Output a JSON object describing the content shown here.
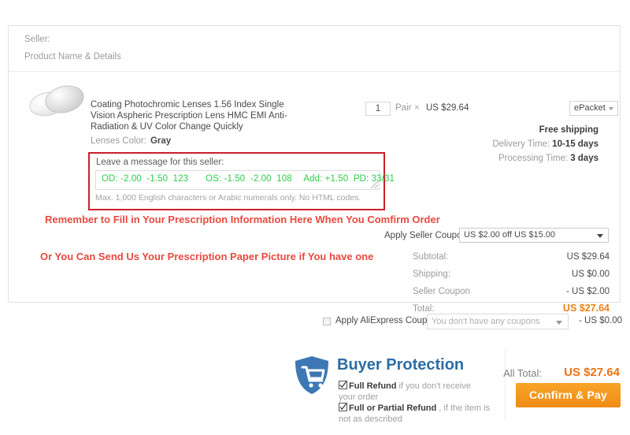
{
  "card": {
    "seller_label": "Seller:",
    "product_header": "Product Name & Details"
  },
  "product": {
    "title": "Coating Photochromic Lenses 1.56 Index Single Vision Aspheric Prescription Lens HMC EMI Anti-Radiation & UV Color Change Quickly",
    "color_label": "Lenses Color:",
    "color_value": "Gray",
    "quantity": "1",
    "unit": "Pair",
    "times": "×",
    "unit_price": "US $29.64",
    "thumbnail_icon": "eyeglass-lenses-icon"
  },
  "message": {
    "label": "Leave a message for this seller:",
    "value": "OD: -2.00  -1.50  123        OS: -1.50  -2.00  108     Add: +1.50  PD: 33/31",
    "prescription": {
      "od_label": "OD:",
      "od_sphere": "-2.00",
      "od_cylinder": "-1.50",
      "od_axis": "123",
      "os_label": "OS:",
      "os_sphere": "-1.50",
      "os_cylinder": "-2.00",
      "os_axis": "108",
      "add_label": "Add:",
      "add_value": "+1.50",
      "pd_label": "PD:",
      "pd_value": "33/31"
    },
    "hint": "Max. 1,000 English characters or Arabic numerals only. No HTML codes.",
    "text_color": "#2ecc4a",
    "box_color": "#cc1f2b"
  },
  "annotations": {
    "note_1": "Remember to Fill in Your Prescription Information Here When You Comfirm Order",
    "note_2": "Or You Can Send Us Your Prescription Paper Picture if You have one",
    "color": "#e8493f"
  },
  "shipping": {
    "method": "ePacket",
    "free_shipping": "Free shipping",
    "delivery_label": "Delivery Time:",
    "delivery_value": "10-15 days",
    "processing_label": "Processing Time:",
    "processing_value": "3 days"
  },
  "seller_coupon": {
    "label": "Apply Seller Coupon:",
    "selected": "US $2.00 off US $15.00"
  },
  "totals": [
    {
      "label": "Subtotal:",
      "value": "US $29.64"
    },
    {
      "label": "Shipping:",
      "value": "US $0.00"
    },
    {
      "label": "Seller Coupon",
      "value": "- US $2.00"
    },
    {
      "label": "Total:",
      "value": "US $27.64"
    }
  ],
  "ali_coupon": {
    "label": "Apply AliExpress Coupon:",
    "placeholder": "You don't have any coupons",
    "amount": "- US $0.00",
    "checked": false
  },
  "buyer_protection": {
    "title": "Buyer Protection",
    "icon": "shield-cart-icon",
    "title_color": "#2e6da4",
    "items": [
      {
        "bold": "Full Refund",
        "rest": " if you don't receive your order"
      },
      {
        "bold": "Full or Partial Refund",
        "rest": " , if the item is not as described"
      }
    ]
  },
  "checkout": {
    "all_total_label": "All Total:",
    "all_total_value": "US $27.64",
    "confirm_label": "Confirm & Pay",
    "accent_color": "#ec7211"
  }
}
